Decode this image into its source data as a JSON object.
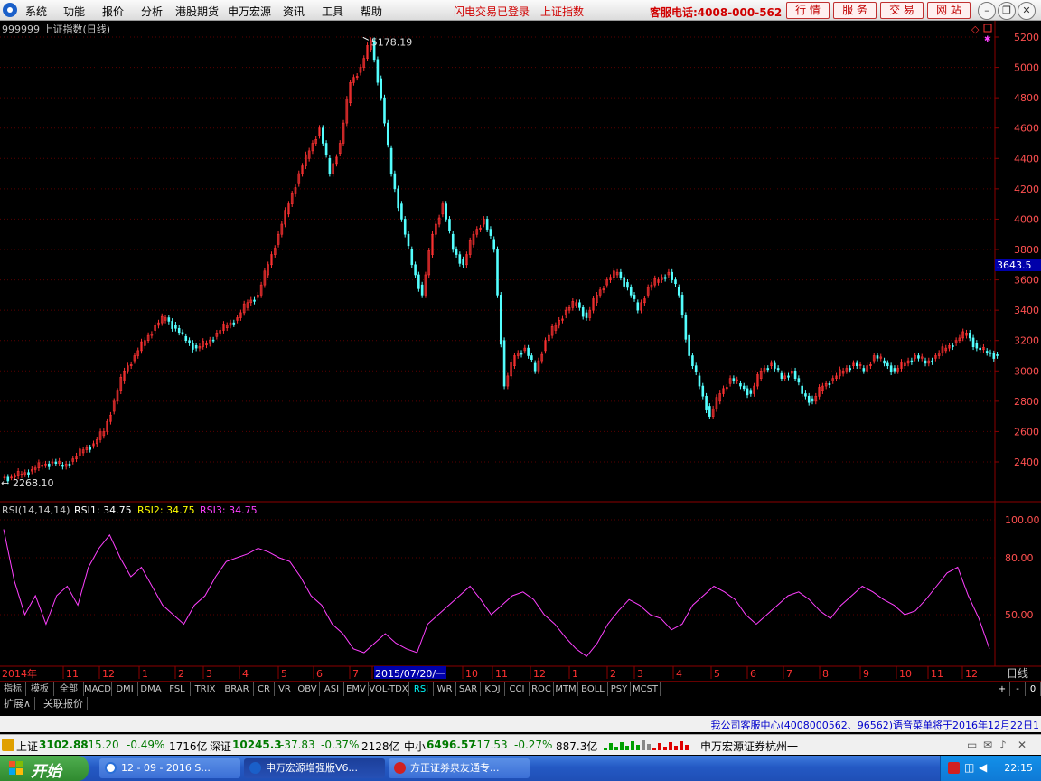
{
  "menu": {
    "items": [
      "系统",
      "功能",
      "报价",
      "分析",
      "港股期货",
      "申万宏源",
      "资讯",
      "工具",
      "帮助"
    ],
    "flash_status": "闪电交易已登录",
    "current_index": "上证指数",
    "hotline": "客服电话:4008-000-562",
    "buttons": [
      "行 情",
      "服 务",
      "交 易",
      "网 站"
    ]
  },
  "chart": {
    "title": "999999 上证指数(日线)",
    "high_label": "5178.19",
    "low_label": "2268.10",
    "last_price": "3643.5",
    "price_axis": [
      "5200",
      "5000",
      "4800",
      "4600",
      "4400",
      "4200",
      "4000",
      "3800",
      "3600",
      "3400",
      "3200",
      "3000",
      "2800",
      "2600",
      "2400"
    ],
    "rsi_header": {
      "name": "RSI(14,14,14)",
      "rsi1": "RSI1: 34.75",
      "rsi2": "RSI2: 34.75",
      "rsi3": "RSI3: 34.75"
    },
    "rsi_axis": [
      "100.00",
      "80.00",
      "50.00"
    ],
    "date_axis": [
      "2014年",
      "11",
      "12",
      "1",
      "2",
      "3",
      "4",
      "5",
      "6",
      "7",
      "2015/07/20/一",
      "10",
      "11",
      "12",
      "1",
      "2",
      "3",
      "4",
      "5",
      "6",
      "7",
      "8",
      "9",
      "10",
      "11",
      "12"
    ],
    "period": "日线",
    "colors": {
      "up": "#ff3232",
      "down": "#54ffff",
      "rsi": "#ff40ff",
      "rsi2": "#ffff00",
      "grid": "#8b0000"
    }
  },
  "chart_data": {
    "type": "line",
    "series": [
      {
        "name": "上证指数",
        "values": [
          2300,
          2320,
          2350,
          2380,
          2400,
          2370,
          2420,
          2480,
          2520,
          2600,
          2800,
          3000,
          3100,
          3200,
          3300,
          3350,
          3280,
          3200,
          3150,
          3180,
          3250,
          3300,
          3350,
          3450,
          3500,
          3700,
          3900,
          4100,
          4300,
          4450,
          4600,
          4300,
          4500,
          4900,
          5000,
          5178,
          4800,
          4300,
          4000,
          3700,
          3500,
          3900,
          4100,
          3800,
          3700,
          3900,
          4000,
          3800,
          2900,
          3100,
          3150,
          3000,
          3200,
          3300,
          3400,
          3450,
          3350,
          3500,
          3600,
          3650,
          3550,
          3400,
          3550,
          3600,
          3650,
          3500,
          3100,
          2900,
          2700,
          2850,
          2950,
          2900,
          2850,
          3000,
          3050,
          2950,
          3000,
          2850,
          2800,
          2900,
          2950,
          3000,
          3050,
          3000,
          3100,
          3050,
          3000,
          3050,
          3100,
          3050,
          3100,
          3150,
          3200,
          3250,
          3150,
          3120,
          3100
        ]
      },
      {
        "name": "RSI1",
        "values": [
          95,
          68,
          50,
          60,
          45,
          60,
          65,
          55,
          75,
          85,
          92,
          80,
          70,
          75,
          65,
          55,
          50,
          45,
          55,
          60,
          70,
          78,
          80,
          82,
          85,
          83,
          80,
          78,
          70,
          60,
          55,
          45,
          40,
          32,
          30,
          35,
          40,
          35,
          32,
          30,
          45,
          50,
          55,
          60,
          65,
          58,
          50,
          55,
          60,
          62,
          58,
          50,
          45,
          38,
          32,
          28,
          35,
          45,
          52,
          58,
          55,
          50,
          48,
          42,
          45,
          55,
          60,
          65,
          62,
          58,
          50,
          45,
          50,
          55,
          60,
          62,
          58,
          52,
          48,
          55,
          60,
          65,
          62,
          58,
          55,
          50,
          52,
          58,
          65,
          72,
          75,
          60,
          48,
          32
        ]
      }
    ],
    "ylim": [
      2200,
      5300
    ],
    "rsi_ylim": [
      30,
      100
    ]
  },
  "tabs": [
    "指标",
    "模板",
    "全部",
    "MACD",
    "DMI",
    "DMA",
    "FSL",
    "TRIX",
    "BRAR",
    "CR",
    "VR",
    "OBV",
    "ASI",
    "EMV",
    "VOL-TDX",
    "RSI",
    "WR",
    "SAR",
    "KDJ",
    "CCI",
    "ROC",
    "MTM",
    "BOLL",
    "PSY",
    "MCST"
  ],
  "active_tab": "RSI",
  "tab_controls": [
    "+",
    "-",
    "0"
  ],
  "subtabs": [
    "扩展∧",
    "关联报价"
  ],
  "message": "我公司客服中心(4008000562、96562)语音菜单将于2016年12月22日1",
  "status": {
    "sh_name": "上证",
    "sh_value": "3102.88",
    "sh_change": "-15.20",
    "sh_pct": "-0.49%",
    "sh_amount": "1716亿",
    "sz_name": "深证",
    "sz_value": "10245.3",
    "sz_change": "-37.83",
    "sz_pct": "-0.37%",
    "sz_amount": "2128亿",
    "zx_name": "中小",
    "zx_value": "6496.57",
    "zx_change": "-17.53",
    "zx_pct": "-0.27%",
    "zx_amount": "887.3亿",
    "broker": "申万宏源证券杭州一"
  },
  "taskbar": {
    "start": "开始",
    "tasks": [
      "12 - 09 - 2016 S...",
      "申万宏源增强版V6...",
      "方正证券泉友通专..."
    ],
    "clock": "22:15"
  }
}
